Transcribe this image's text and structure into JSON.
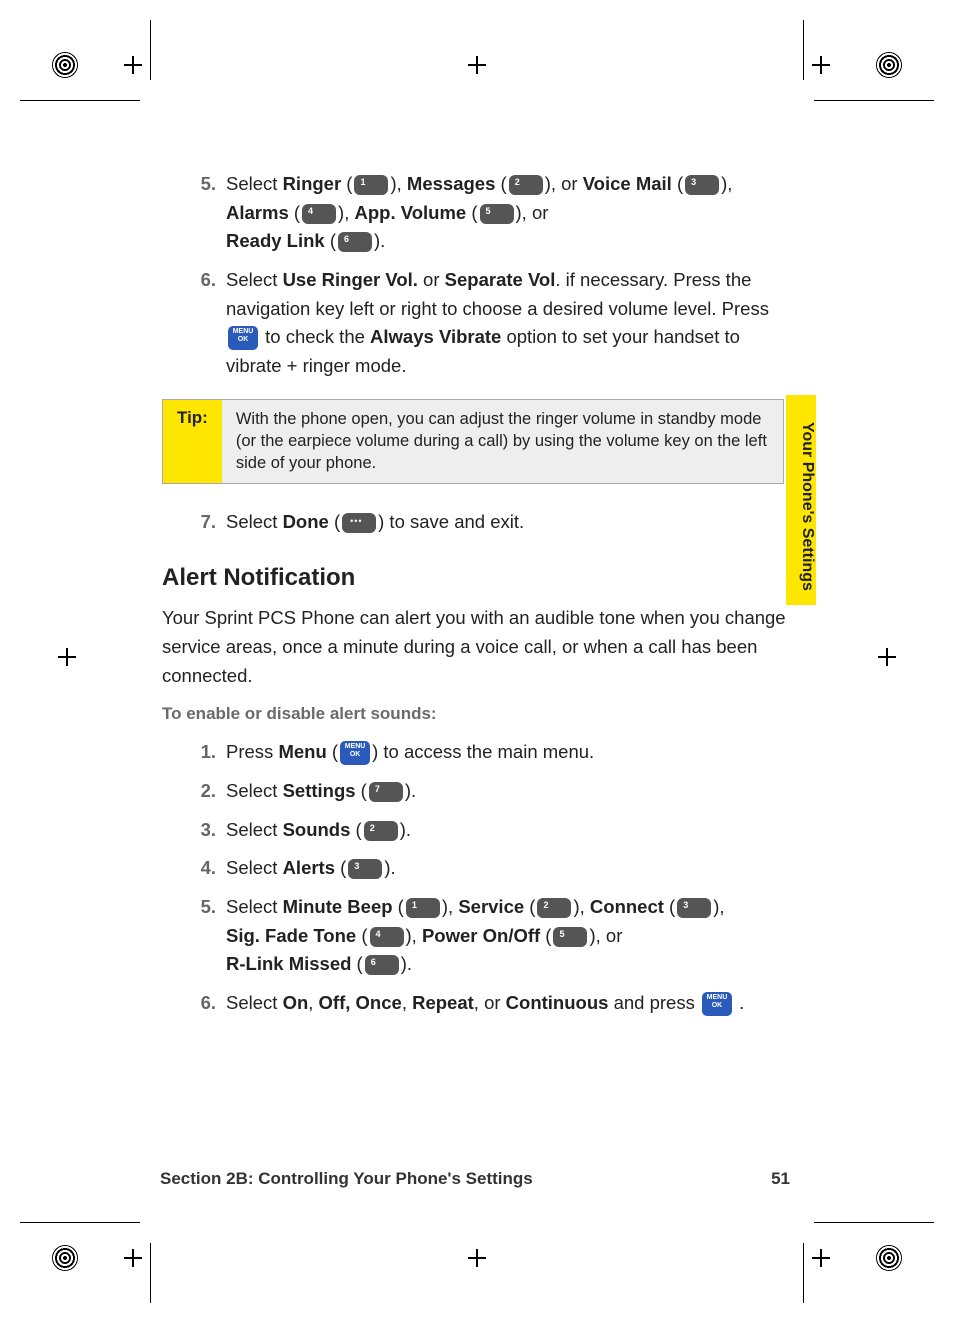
{
  "sidetab": "Your Phone's Settings",
  "steps_top": {
    "s5": {
      "num": "5.",
      "t_select": "Select ",
      "ringer": "Ringer",
      "messages": "Messages",
      "voicemail": "Voice Mail",
      "alarms": "Alarms",
      "appvolume": "App. Volume",
      "readylink": "Ready Link",
      "or_txt": ", or"
    },
    "s6": {
      "num": "6.",
      "t_select": "Select ",
      "useRinger": "Use Ringer Vol.",
      "or_word": " or ",
      "sepVol": "Separate Vol",
      "after1": ". if necessary. Press the navigation key left or right to choose a desired volume level. Press ",
      "after2": " to check the ",
      "always": "Always Vibrate",
      "after3": " option to set your handset to vibrate + ringer mode."
    },
    "s7": {
      "num": "7.",
      "t_select": "Select ",
      "done": "Done",
      "after": " to save and exit."
    }
  },
  "tip": {
    "label": "Tip:",
    "text": "With the phone open, you can adjust the ringer volume in standby mode (or the earpiece volume during a call) by using the volume key on the left side of your phone."
  },
  "heading": "Alert Notification",
  "intro": "Your Sprint PCS Phone can alert you with an audible tone when you change service areas, once a minute during a voice call, or when a call has been connected.",
  "subhead": "To enable or disable alert sounds:",
  "steps_bottom": {
    "s1": {
      "num": "1.",
      "pre": "Press ",
      "bold": "Menu",
      "after": " to access the main menu."
    },
    "s2": {
      "num": "2.",
      "pre": "Select ",
      "bold": "Settings"
    },
    "s3": {
      "num": "3.",
      "pre": "Select ",
      "bold": "Sounds"
    },
    "s4": {
      "num": "4.",
      "pre": "Select ",
      "bold": "Alerts"
    },
    "s5": {
      "num": "5.",
      "pre": "Select ",
      "minute": "Minute Beep",
      "service": "Service",
      "connect": "Connect",
      "sigfade": "Sig. Fade Tone",
      "power": "Power On/Off",
      "or_txt": ", or ",
      "rlink": "R-Link Missed"
    },
    "s6": {
      "num": "6.",
      "pre": "Select ",
      "on": "On",
      "off": "Off, Once",
      "repeat": "Repeat",
      "cont": "Continuous",
      "mid": ", or ",
      "after": " and press "
    }
  },
  "footer": {
    "left": "Section 2B: Controlling Your Phone's Settings",
    "right": "51"
  }
}
